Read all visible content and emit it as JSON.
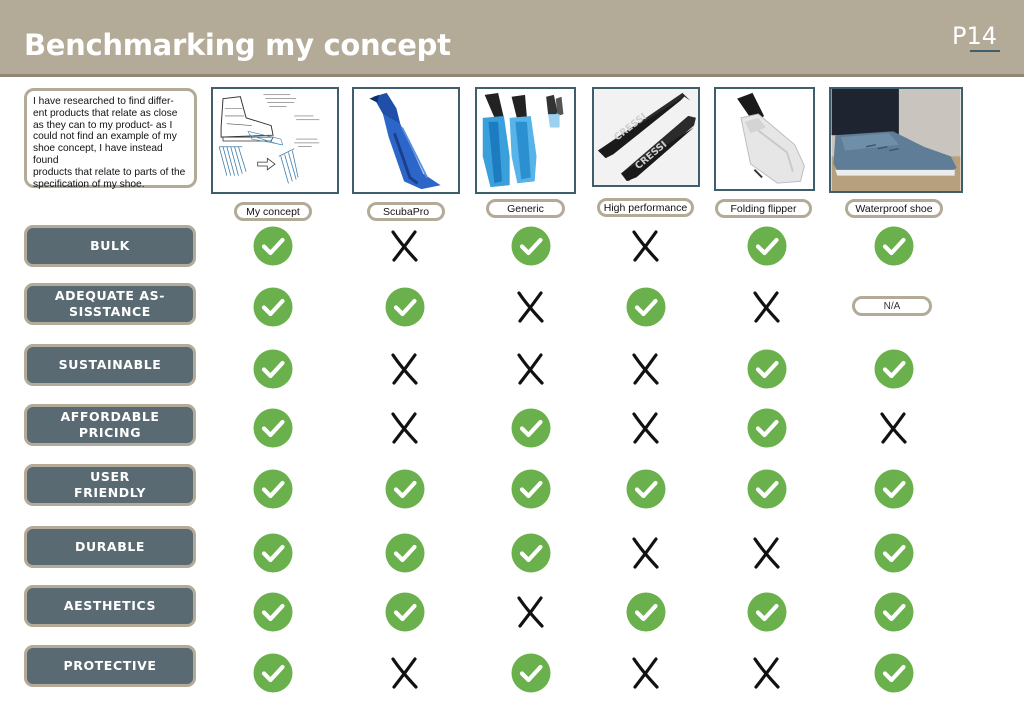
{
  "header": {
    "title": "Benchmarking my concept",
    "page": "P14"
  },
  "intro": "I have researched to find differ-\nent products that relate as close\nas they can to my product- as I\ncould not find an example of my\nshoe concept, I have instead found\nproducts that relate to parts of the\nspecification of my shoe.",
  "products": [
    {
      "label": "My concept",
      "image": "concept-sketch-image"
    },
    {
      "label": "ScubaPro",
      "image": "scubapro-fin-image"
    },
    {
      "label": "Generic",
      "image": "generic-fin-image"
    },
    {
      "label": "High performance",
      "image": "high-performance-fin-image"
    },
    {
      "label": "Folding flipper",
      "image": "folding-flipper-image"
    },
    {
      "label": "Waterproof shoe",
      "image": "waterproof-shoe-image"
    }
  ],
  "criteria": [
    {
      "label": "BULK",
      "results": [
        "check",
        "cross",
        "check",
        "cross",
        "check",
        "check"
      ]
    },
    {
      "label": "ADEQUATE AS-\nSISSTANCE",
      "results": [
        "check",
        "check",
        "cross",
        "check",
        "cross",
        "N/A"
      ]
    },
    {
      "label": "SUSTAINABLE",
      "results": [
        "check",
        "cross",
        "cross",
        "cross",
        "check",
        "check"
      ]
    },
    {
      "label": "AFFORDABLE\nPRICING",
      "results": [
        "check",
        "cross",
        "check",
        "cross",
        "check",
        "cross"
      ]
    },
    {
      "label": "USER\nFRIENDLY",
      "results": [
        "check",
        "check",
        "check",
        "check",
        "check",
        "check"
      ]
    },
    {
      "label": "DURABLE",
      "results": [
        "check",
        "check",
        "check",
        "cross",
        "cross",
        "check"
      ]
    },
    {
      "label": "AESTHETICS",
      "results": [
        "check",
        "check",
        "cross",
        "check",
        "check",
        "check"
      ]
    },
    {
      "label": "PROTECTIVE",
      "results": [
        "check",
        "cross",
        "check",
        "cross",
        "cross",
        "check"
      ]
    }
  ],
  "colors": {
    "header": "#b3aa98",
    "row_label": "#5a6a72",
    "check": "#6ab04c",
    "cross": "#111111",
    "border": "#b3aa98"
  }
}
